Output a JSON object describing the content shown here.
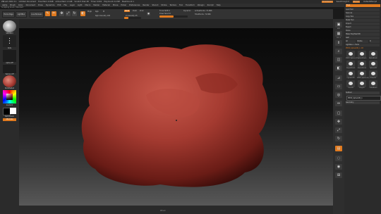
{
  "titlebar": {
    "app": "ZBrush 2021.5.1",
    "document": "Untitled Document",
    "items": [
      "Free Mem 4.6GB",
      "Active Mem 1.1GB",
      "Scratch Disk 48",
      "Timer 0.001",
      "PolyCount 2.4 MP",
      "MeshCount 1"
    ],
    "right_items": [
      "QuickSave",
      "See-through 0",
      "Menus",
      "DefaultZScript"
    ]
  },
  "menubar": {
    "items": [
      "Alpha",
      "Brush",
      "Color",
      "Document",
      "Draw",
      "Dynamics",
      "Edit",
      "File",
      "Layer",
      "Light",
      "Macro",
      "Marker",
      "Material",
      "Movie",
      "Picker",
      "Preferences",
      "Render",
      "Stencil",
      "Stroke",
      "Texture",
      "Tool",
      "Transform",
      "Zplugin",
      "Zscript",
      "Help"
    ]
  },
  "infoline": "Sculpting brush: Standard",
  "toolshelf": {
    "home_page": "Home Page",
    "lightbox": "LightBox",
    "live_boolean": "Live Boolean",
    "edit": "Edit",
    "draw": "Draw",
    "move": "Move",
    "scale": "Scale",
    "rotate": "Rotate",
    "mrgb": "Mrgb",
    "rgb": "Rgb",
    "m": "M",
    "zadd": "Zadd",
    "zsub": "Zsub",
    "zcut": "Zcut",
    "focal_shift_label": "Focal Shift 0",
    "z_intensity_label": "Z Intensity 25",
    "draw_size_label": "Draw Size 64",
    "dynamic": "Dynamic",
    "rgb_intensity_label": "Rgb Intensity 100",
    "active_points": "ActivePoints: 72,866",
    "total_points": "TotalPoints: 72,866",
    "z_intensity": 0.25,
    "rgb_intensity": 1.0,
    "draw_size": 0.5
  },
  "leftbar": {
    "brush_label": "Standard",
    "stroke_label": "Dots",
    "alpha_label": "Alpha Off",
    "texture_label": "Texture Off",
    "material_label": "SkinShade4",
    "gradient_label": "Gradient",
    "switch_color_label": "SwitchColor",
    "alternate_label": "Alternate"
  },
  "rightstrip": {
    "buttons": [
      "BPR",
      "SPix 3",
      "Scroll",
      "Zoom",
      "Actual",
      "AAHalf",
      "Persp",
      "Floor",
      "Local",
      "L.Sym",
      "Frame",
      "Move",
      "Scale",
      "Rotate",
      "Line Fill",
      "PolyF",
      "Transp",
      "Solo",
      "Xpose"
    ]
  },
  "rightpanel": {
    "title": "Tool",
    "rows": [
      "Load Tool",
      "Save As",
      "Copy Tool",
      "Paste Tool",
      "Import",
      "Export",
      "Clone",
      "Make PolyMesh3D",
      "GoZ",
      "All",
      "Visible",
      "R",
      "Lightbox > Tools"
    ],
    "current_tool": "PM3D_Sphere3D_1. 48",
    "thumbs": [
      "PM3D_Sphere3D",
      "SphereBrush",
      "AlphaBrush",
      "SimpleBrush",
      "EraserBrush",
      "Sphere3D",
      "Cylinder3D",
      "PM3D_Sphere3D_1",
      "Cube3D",
      "Cone3D",
      "Ring3D",
      "CubeBrush"
    ],
    "subtool_label": "Subtool",
    "subtool_item": "PM3D_Sphere3D_1",
    "geometry_label": "Geometry"
  },
  "colors": {
    "accent": "#e07a1f",
    "mesh": "#a83a32",
    "background": "#1a1a1a"
  },
  "footer": {
    "center": "ZBrush"
  }
}
